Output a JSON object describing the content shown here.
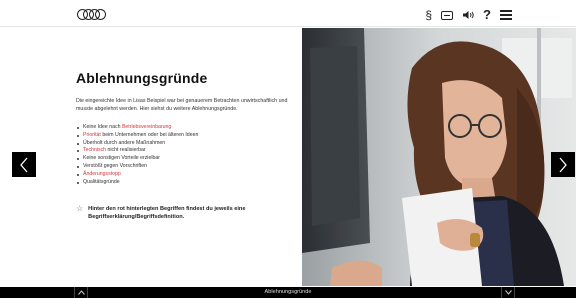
{
  "header": {
    "icons": [
      "audi-logo",
      "paragraph-icon",
      "book-icon",
      "speaker-icon",
      "help-icon",
      "menu-icon"
    ],
    "paragraph_glyph": "§",
    "help_glyph": "?"
  },
  "content": {
    "title": "Ablehnungsgründe",
    "intro": "Die eingereichte Idee in Lisas Beispiel war bei genauerem Betrachten unwirtschaftlich und musste abgelehnt werden. Hier siehst du weitere Ablehnungsgründe.",
    "bullets": [
      {
        "pre": "",
        "red": "",
        "post": "Keine Idee nach "
      },
      {
        "pre": "",
        "red": "Priorität",
        "post": " beim Unternehmen oder bei älteren Ideen"
      },
      {
        "pre": "Überholt durch andere Maßnahmen",
        "red": "",
        "post": ""
      },
      {
        "pre": "",
        "red": "Technisch",
        "post": " nicht realisierbar"
      },
      {
        "pre": "Keine sonstigen Vorteile erzielbar",
        "red": "",
        "post": ""
      },
      {
        "pre": "Verstößt gegen Vorschriften",
        "red": "",
        "post": ""
      },
      {
        "pre": "",
        "red": "Änderungsstopp",
        "post": ""
      },
      {
        "pre": "Qualitätsgründe",
        "red": "",
        "post": ""
      }
    ],
    "bullet1_red": "Betriebsvereinbarung",
    "note": "Hinter den rot hinterlegten Begriffen findest du jeweils eine Begriffserklärung/Begriffsdefinition."
  },
  "bottom_bar": {
    "title": "Ablehnungsgründe"
  },
  "colors": {
    "accent_red": "#d0383c",
    "bar": "#000000"
  }
}
